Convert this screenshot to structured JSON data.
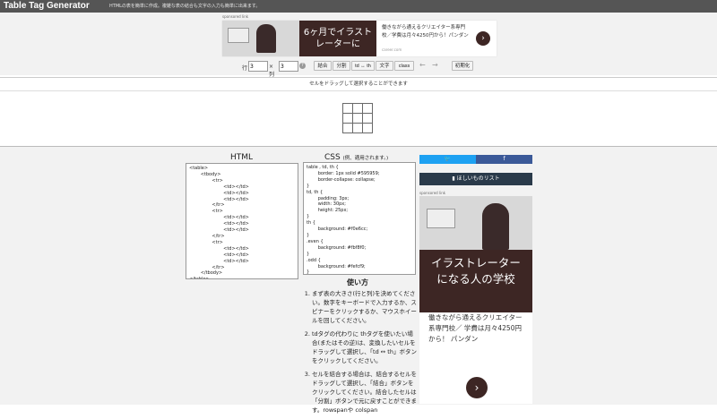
{
  "header": {
    "logo": "Table Tag Generator",
    "tagline": "HTMLの表を簡単に作成。複雑な表の結合も文字の入力も簡単に出来ます。"
  },
  "ad_top": {
    "sponsored": "sponsored link",
    "banner_text": "6ヶ月でイラストレーターに",
    "text": "働きながら通えるクリエイター系専門校／学費は月々4250円から！パンダン",
    "url": "career.com",
    "arrow": "›"
  },
  "controls": {
    "rows_label": "行",
    "rows_value": "3",
    "cols_label": "× 列",
    "cols_value": "3",
    "help": "?",
    "buttons": [
      "結合",
      "分割",
      "td ↔ th",
      "文字",
      "class"
    ],
    "undo": "←",
    "redo": "→",
    "reset": "初期化"
  },
  "info": "セルをドラッグして選択することができます",
  "html_panel": {
    "title": "HTML",
    "code": "<table>\n        <tbody>\n                <tr>\n                        <td></td>\n                        <td></td>\n                        <td></td>\n                </tr>\n                <tr>\n                        <td></td>\n                        <td></td>\n                        <td></td>\n                </tr>\n                <tr>\n                        <td></td>\n                        <td></td>\n                        <td></td>\n                </tr>\n        </tbody>\n</table>"
  },
  "css_panel": {
    "title": "CSS",
    "note": "(例、適用されます。)",
    "code": "table , td, th {\n        border: 1px solid #595959;\n        border-collapse: collapse;\n}\ntd, th {\n        padding: 3px;\n        width: 30px;\n        height: 25px;\n}\nth {\n        background: #f0e6cc;\n}\n.even {\n        background: #fbf8f0;\n}\n.odd {\n        background: #fefcf9;\n}"
  },
  "howto": {
    "title": "使い方",
    "steps": [
      "まず表の大きさ(行と列)を決めてください。数字をキーボードで入力するか、スピナーをクリックするか、マウスホイールを回してください。",
      "tdタグの代わりに thタグを使いたい場合(またはその逆)は、変換したいセルをドラッグして選択し、「td ↔ th」ボタンをクリックしてください。",
      "セルを結合する場合は、結合するセルをドラッグして選択し、「結合」ボタンをクリックしてください。結合したセルは「分割」ボタンで元に戻すことができます。rowspanや colspan"
    ]
  },
  "sidebar": {
    "twitter": "🐦",
    "facebook": "f",
    "wishlist": "ほしいものリスト",
    "ad": {
      "sponsored": "sponsored link",
      "banner_text": "イラストレーター\nになる人の学校",
      "text": "働きながら通えるクリエイター系専門校／ 学費は月々4250円から！ パンダン",
      "arrow": "›"
    }
  },
  "colors": {
    "header": "#555555",
    "ad_dark": "#3d2624",
    "twitter": "#1da1f2",
    "facebook": "#3b5998",
    "wishlist": "#2a3a4a"
  }
}
